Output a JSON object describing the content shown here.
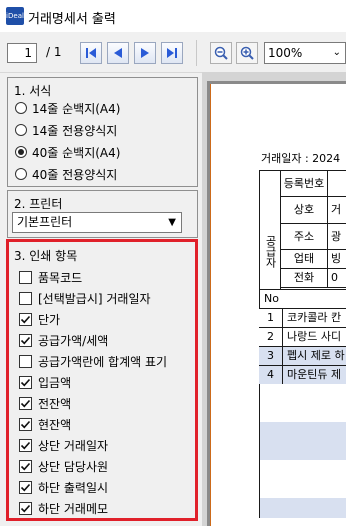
{
  "window": {
    "title": "거래명세서 출력",
    "icon_text": "iDeal"
  },
  "toolbar": {
    "current_page": "1",
    "total_pages": "/ 1",
    "zoom": "100%",
    "icons": [
      "first-page-icon",
      "prev-page-icon",
      "next-page-icon",
      "last-page-icon",
      "zoom-out-icon",
      "zoom-in-icon"
    ]
  },
  "format_group": {
    "title": "1. 서식",
    "options": [
      "14줄 순백지(A4)",
      "14줄 전용양식지",
      "40줄 순백지(A4)",
      "40줄 전용양식지"
    ],
    "selected_index": 2
  },
  "printer_group": {
    "title": "2. 프린터",
    "selected": "기본프린터"
  },
  "print_items_group": {
    "title": "3. 인쇄 항목",
    "items": [
      {
        "label": "품목코드",
        "checked": false
      },
      {
        "label": "[선택발급시] 거래일자",
        "checked": false
      },
      {
        "label": "단가",
        "checked": true
      },
      {
        "label": "공급가액/세액",
        "checked": true
      },
      {
        "label": "공급가액란에 합계액 표기",
        "checked": false
      },
      {
        "label": "입금액",
        "checked": true
      },
      {
        "label": "전잔액",
        "checked": true
      },
      {
        "label": "현잔액",
        "checked": true
      },
      {
        "label": "상단 거래일자",
        "checked": true
      },
      {
        "label": "상단 담당사원",
        "checked": true
      },
      {
        "label": "하단 출력일시",
        "checked": true
      },
      {
        "label": "하단 거래메모",
        "checked": true
      }
    ],
    "highlight_color": "#e0202a"
  },
  "preview": {
    "date_label": "거래일자 : 2024",
    "supplier_label": "공급자",
    "fields": [
      "등록번호",
      "상호",
      "주소",
      "업태",
      "전화"
    ],
    "field_values": [
      "",
      "거",
      "광",
      "빙",
      "0"
    ],
    "col_no": "No",
    "rows": [
      {
        "no": "1",
        "name": "코카콜라 칸"
      },
      {
        "no": "2",
        "name": "나랑드 사디"
      },
      {
        "no": "3",
        "name": "펩시 제로 하"
      },
      {
        "no": "4",
        "name": "마운틴듀 제"
      }
    ],
    "row_shade_color": "#d8e0f0"
  }
}
